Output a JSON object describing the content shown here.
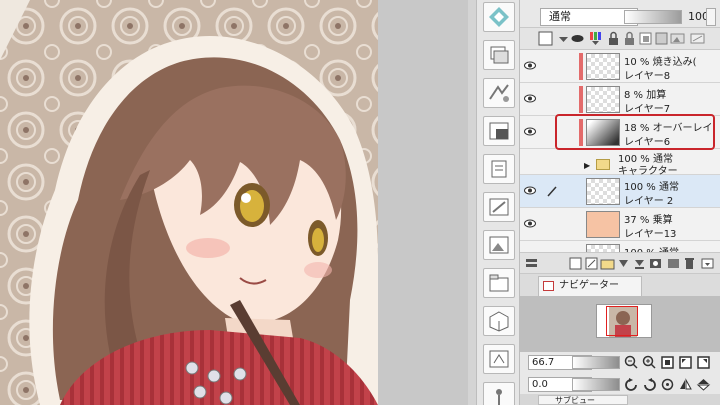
{
  "layer_properties": {
    "blend_mode": "通常",
    "opacity": "100"
  },
  "layers": [
    {
      "mode": "10 % 焼き込み(",
      "name": "レイヤー8",
      "visible": true,
      "thumb": "checker"
    },
    {
      "mode": "8 % 加算",
      "name": "レイヤー7",
      "visible": true,
      "thumb": "checker"
    },
    {
      "mode": "18 % オーバーレイ",
      "name": "レイヤー6",
      "visible": true,
      "thumb": "gradient",
      "highlighted": true
    },
    {
      "mode": "100 % 通常",
      "name": "キャラクター",
      "visible": false,
      "type": "folder"
    },
    {
      "mode": "100 % 通常",
      "name": "レイヤー 2",
      "visible": true,
      "thumb": "checker",
      "selected": true
    },
    {
      "mode": "37 % 乗算",
      "name": "レイヤー13",
      "visible": true,
      "thumb": "peach"
    },
    {
      "mode": "100 % 通常",
      "name": "",
      "visible": true,
      "thumb": "checker"
    }
  ],
  "navigator": {
    "tab_label": "ナビゲーター",
    "zoom": "66.7",
    "rotation": "0.0"
  },
  "sub_panel": {
    "tab_label": "サブビュー"
  },
  "colors": {
    "highlight": "#c9252b",
    "selected_row": "#dbe8f6",
    "layer_marker": "#e36b6b"
  }
}
